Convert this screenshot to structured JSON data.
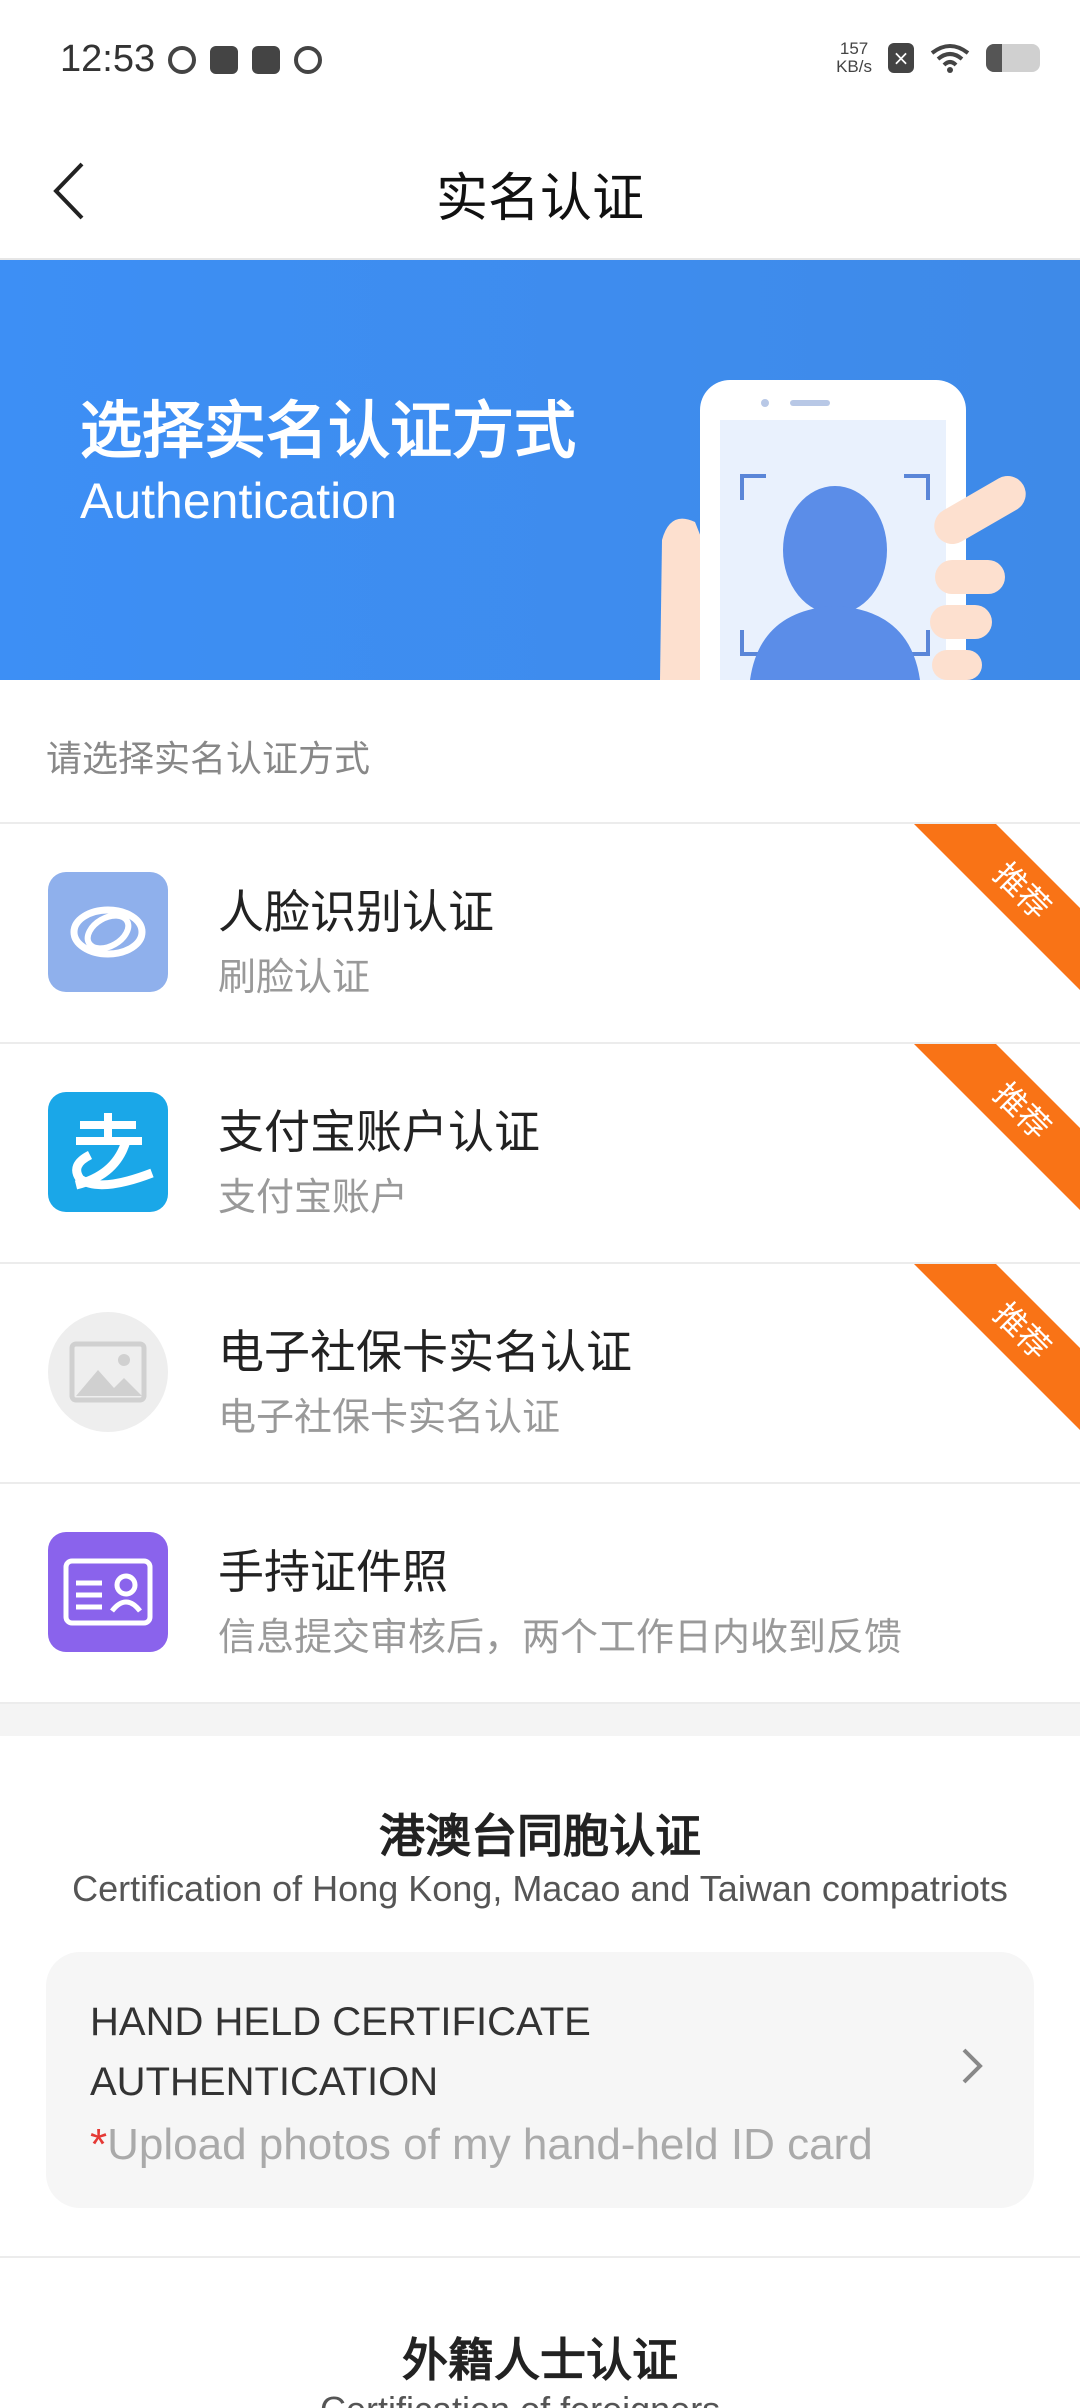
{
  "status_bar": {
    "time": "12:53",
    "speed_top": "157",
    "speed_unit": "KB/s"
  },
  "nav": {
    "title": "实名认证"
  },
  "banner": {
    "title": "选择实名认证方式",
    "subtitle": "Authentication"
  },
  "hint": "请选择实名认证方式",
  "methods": [
    {
      "title": "人脸识别认证",
      "subtitle": "刷脸认证",
      "badge": "推荐",
      "icon": "face-recognition-icon",
      "color": "#8fb0ec"
    },
    {
      "title": "支付宝账户认证",
      "subtitle": "支付宝账户",
      "badge": "推荐",
      "icon": "alipay-icon",
      "color": "#1aa7e8"
    },
    {
      "title": "电子社保卡实名认证",
      "subtitle": "电子社保卡实名认证",
      "badge": "推荐",
      "icon": "image-placeholder-icon",
      "color": "#eeeeee"
    },
    {
      "title": "手持证件照",
      "subtitle": "信息提交审核后，两个工作日内收到反馈",
      "icon": "id-card-icon",
      "color": "#8a63ec"
    }
  ],
  "hk_section": {
    "title": "港澳台同胞认证",
    "subtitle": "Certification of Hong Kong, Macao and Taiwan compatriots",
    "card_title": "HAND HELD CERTIFICATE\n AUTHENTICATION",
    "card_required_mark": "*",
    "card_desc": "Upload photos of my hand-held ID card"
  },
  "foreign_section": {
    "title": "外籍人士认证",
    "subtitle_partial": "Certification of foreigners"
  },
  "colors": {
    "banner": "#3d8ff5",
    "ribbon": "#f97316"
  }
}
